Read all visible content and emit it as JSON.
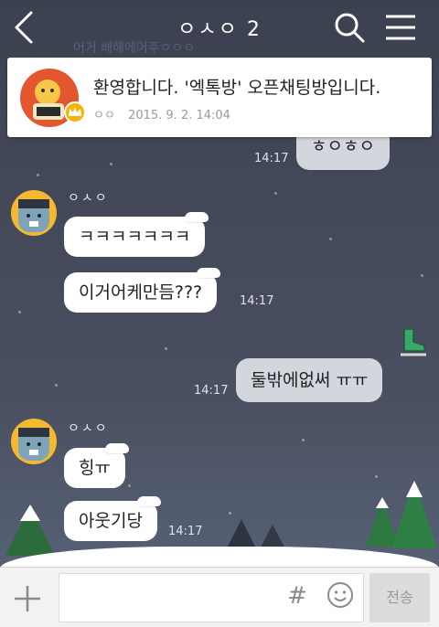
{
  "header": {
    "title": "ㅇㅅㅇ 2"
  },
  "ghost_message": "어거 배해에어주ㅇㅇㅇ",
  "notice": {
    "text": "환영합니다. '엑톡방' 오픈채팅방입니다.",
    "author": "ㅇㅇ",
    "datetime": "2015. 9. 2. 14:04"
  },
  "messages": [
    {
      "text": "ㅎㅇㅎㅇ",
      "time": "14:17"
    },
    {
      "sender": "ㅇㅅㅇ",
      "text": "ㅋㅋㅋㅋㅋㅋㅋ"
    },
    {
      "text": "이거어케만듬???",
      "time": "14:17"
    },
    {
      "text": "둘밖에없써 ㅠㅠ",
      "time": "14:17"
    },
    {
      "sender": "ㅇㅅㅇ",
      "text": "힝ㅠ"
    },
    {
      "text": "아웃기당",
      "time": "14:17"
    }
  ],
  "input": {
    "value": "",
    "hash_label": "#",
    "send_label": "전송"
  },
  "icons": {
    "back": "chevron-left-icon",
    "search": "search-icon",
    "menu": "hamburger-menu-icon",
    "plus": "plus-icon",
    "emoji": "smiley-icon"
  },
  "colors": {
    "background": "#3f4453",
    "bubble": "#ffffff",
    "my_bubble": "#d3d6dd",
    "notice_avatar": "#e4572e",
    "crown": "#f5b400"
  }
}
